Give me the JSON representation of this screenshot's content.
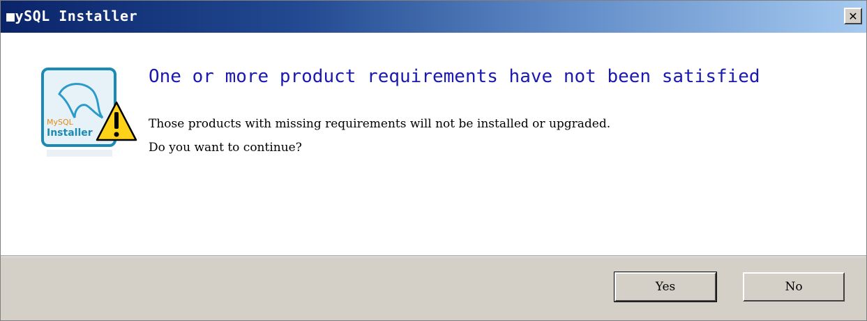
{
  "window": {
    "title": "■ySQL Installer",
    "close_label": "✕"
  },
  "dialog": {
    "icon": "mysql-installer-warning-icon",
    "icon_text_1": "MySQL",
    "icon_text_2": "Installer",
    "heading": "One or more product requirements have not been satisfied",
    "message_line1": "Those products with missing requirements will not be installed or upgraded.",
    "message_line2": "Do you want to continue?"
  },
  "buttons": {
    "yes_label": "Yes",
    "no_label": "No"
  },
  "colors": {
    "heading": "#1a1ab0",
    "titlebar_start": "#0a246a",
    "titlebar_end": "#a6caf0",
    "footer": "#d4d0c8"
  }
}
